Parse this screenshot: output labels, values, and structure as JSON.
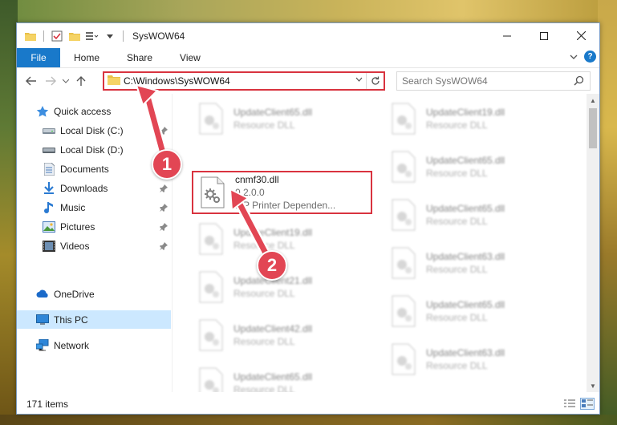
{
  "window": {
    "title": "SysWOW64"
  },
  "ribbon": {
    "file": "File",
    "tabs": [
      "Home",
      "Share",
      "View"
    ]
  },
  "address": {
    "path": "C:\\Windows\\SysWOW64",
    "search_placeholder": "Search SysWOW64"
  },
  "sidebar": {
    "items": [
      {
        "label": "Quick access",
        "icon": "star-icon"
      },
      {
        "label": "Local Disk (C:)",
        "icon": "drive-icon"
      },
      {
        "label": "Local Disk (D:)",
        "icon": "drive-icon"
      },
      {
        "label": "Documents",
        "icon": "documents-icon"
      },
      {
        "label": "Downloads",
        "icon": "downloads-icon"
      },
      {
        "label": "Music",
        "icon": "music-icon"
      },
      {
        "label": "Pictures",
        "icon": "pictures-icon"
      },
      {
        "label": "Videos",
        "icon": "videos-icon"
      },
      {
        "label": "OneDrive",
        "icon": "cloud-icon"
      },
      {
        "label": "This PC",
        "icon": "computer-icon"
      },
      {
        "label": "Network",
        "icon": "network-icon"
      }
    ]
  },
  "files": {
    "left": [
      {
        "name": "UpdateClient65.dll",
        "sub": "Resource DLL"
      },
      {
        "name": "cnmf30.dll",
        "sub": "0.2.0.0",
        "sub2": "MP Printer Dependen..."
      },
      {
        "name": "UpdateClient19.dll",
        "sub": "Resource DLL"
      },
      {
        "name": "UpdateClient21.dll",
        "sub": "Resource DLL"
      },
      {
        "name": "UpdateClient42.dll",
        "sub": "Resource DLL"
      },
      {
        "name": "UpdateClient65.dll",
        "sub": "Resource DLL"
      }
    ],
    "right": [
      {
        "name": "UpdateClient19.dll",
        "sub": "Resource DLL"
      },
      {
        "name": "UpdateClient65.dll",
        "sub": "Resource DLL"
      },
      {
        "name": "UpdateClient65.dll",
        "sub": "Resource DLL"
      },
      {
        "name": "UpdateClient63.dll",
        "sub": "Resource DLL"
      },
      {
        "name": "UpdateClient65.dll",
        "sub": "Resource DLL"
      },
      {
        "name": "UpdateClient63.dll",
        "sub": "Resource DLL"
      }
    ]
  },
  "status": {
    "count": "171 items"
  },
  "callouts": {
    "one": "1",
    "two": "2"
  },
  "colors": {
    "accent": "#1979ca",
    "highlight": "#d9333f",
    "badge": "#e24654",
    "selected": "#cce8ff"
  }
}
